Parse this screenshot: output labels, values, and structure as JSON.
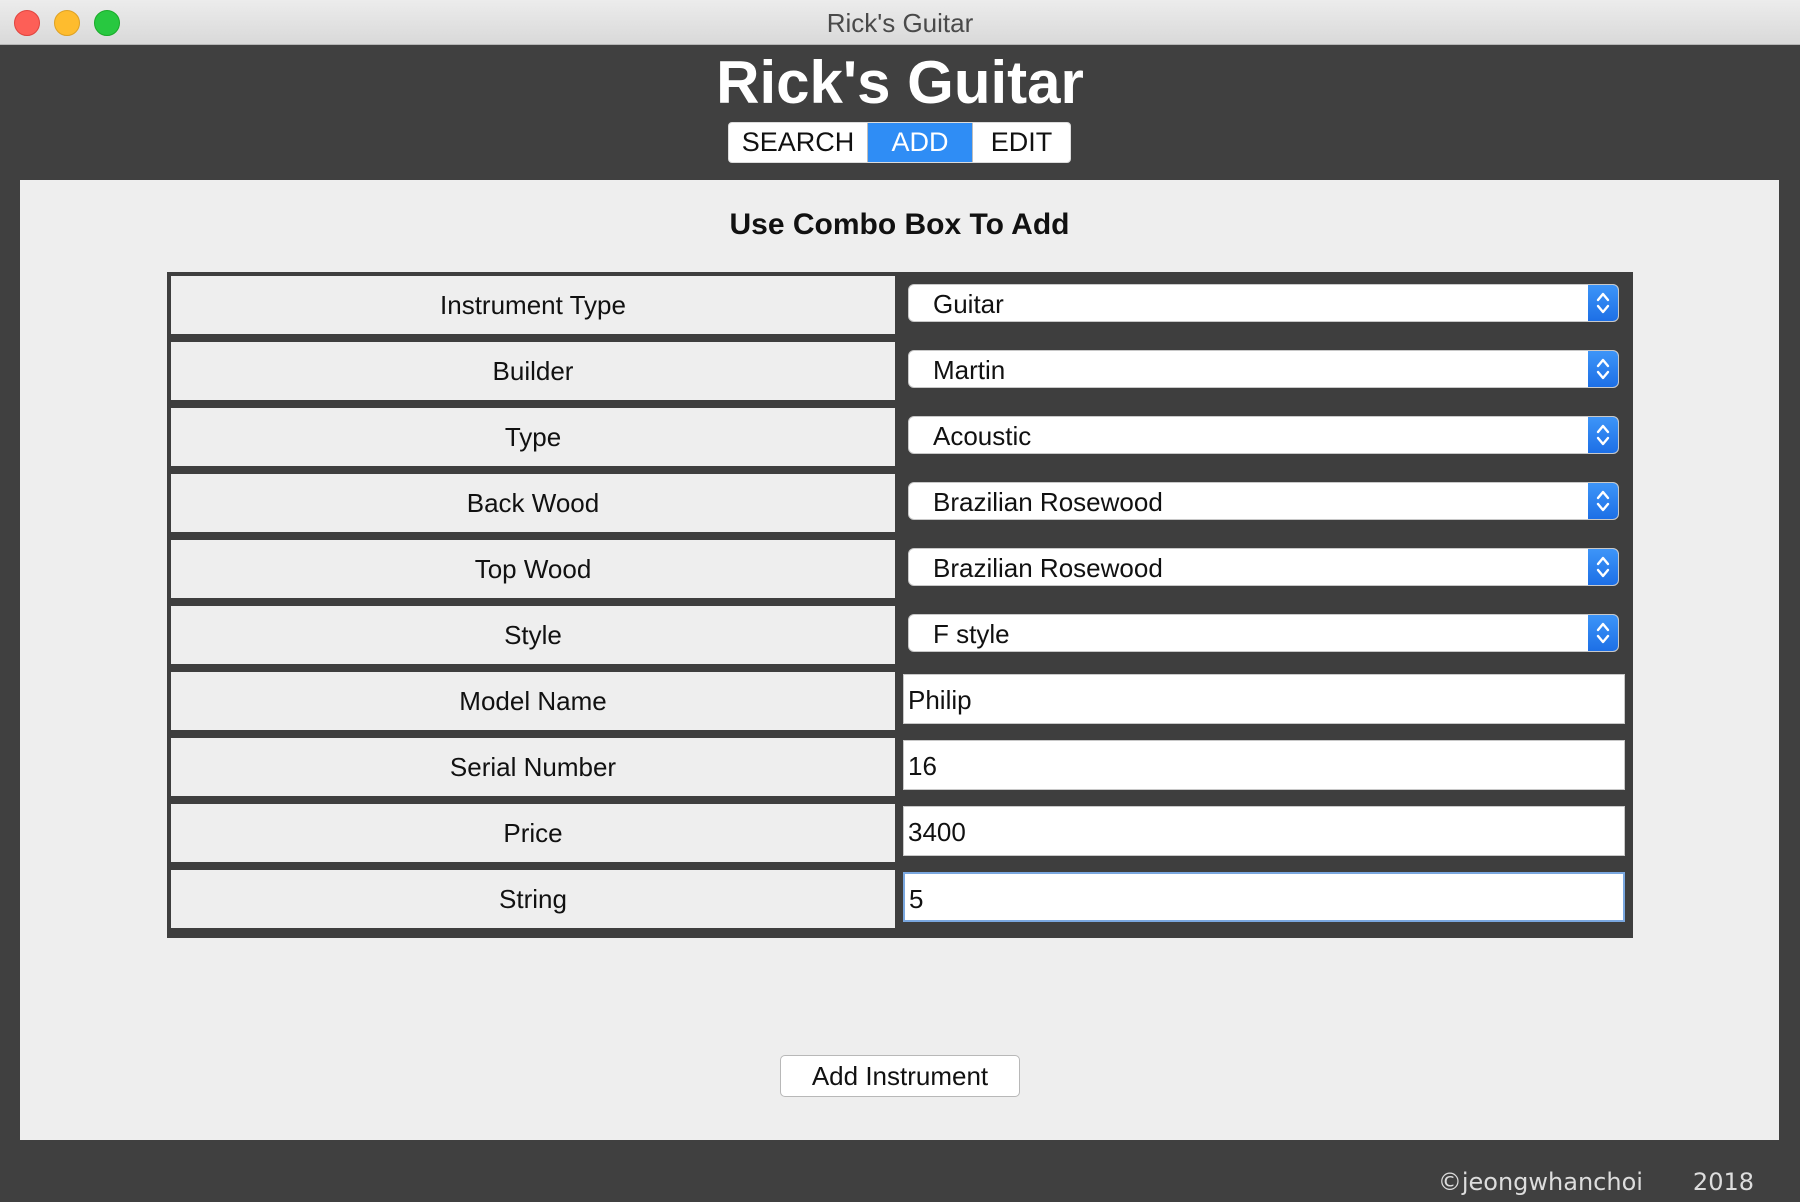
{
  "window": {
    "title": "Rick's Guitar"
  },
  "header": {
    "app_title": "Rick's Guitar"
  },
  "tabs": [
    {
      "label": "SEARCH",
      "active": false
    },
    {
      "label": "ADD",
      "active": true
    },
    {
      "label": "EDIT",
      "active": false
    }
  ],
  "form": {
    "title": "Use Combo Box To Add",
    "rows": [
      {
        "label": "Instrument Type",
        "control": "combo",
        "value": "Guitar"
      },
      {
        "label": "Builder",
        "control": "combo",
        "value": "Martin"
      },
      {
        "label": "Type",
        "control": "combo",
        "value": "Acoustic"
      },
      {
        "label": "Back Wood",
        "control": "combo",
        "value": "Brazilian Rosewood"
      },
      {
        "label": "Top Wood",
        "control": "combo",
        "value": "Brazilian Rosewood"
      },
      {
        "label": "Style",
        "control": "combo",
        "value": "F style"
      },
      {
        "label": "Model Name",
        "control": "text",
        "value": "Philip"
      },
      {
        "label": "Serial Number",
        "control": "text",
        "value": "16"
      },
      {
        "label": "Price",
        "control": "text",
        "value": "3400"
      },
      {
        "label": "String",
        "control": "text",
        "value": "5"
      }
    ],
    "submit_label": "Add Instrument"
  },
  "footer": {
    "credit": "©jeongwhanchoi",
    "year": "2018"
  },
  "colors": {
    "accent": "#2f8df5",
    "background": "#404040",
    "panel": "#eeeeee"
  }
}
